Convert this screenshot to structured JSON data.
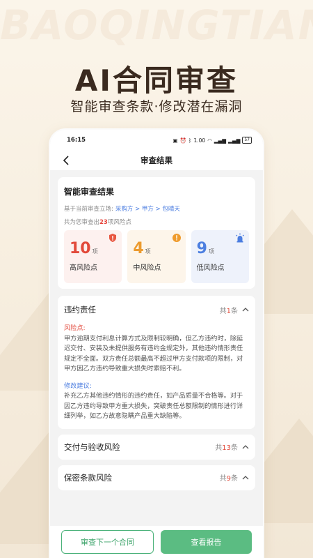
{
  "watermark": "BAOQINGTIAN",
  "hero": {
    "title": "AI合同审查",
    "subtitle": "智能审查条款·修改潜在漏洞"
  },
  "statusbar": {
    "time": "16:15",
    "icons": [
      "nfc-icon",
      "alarm-icon",
      "bluetooth-icon",
      "speed-readout",
      "wifi-icon",
      "signal-icon",
      "signal-icon",
      "battery-icon"
    ],
    "speed": "1.00",
    "battery": "57"
  },
  "nav": {
    "title": "审查结果"
  },
  "summary": {
    "title": "智能审查结果",
    "stance_label": "基于当前审查立场:",
    "stance_path": "采购方 > 甲方 > 包晴天",
    "count_prefix": "共为您审查出",
    "count_num": "23",
    "count_suffix": "项风险点",
    "boxes": [
      {
        "num": "10",
        "unit": "项",
        "label": "高风险点",
        "color": "#e24a3b"
      },
      {
        "num": "4",
        "unit": "项",
        "label": "中风险点",
        "color": "#ec9b2f"
      },
      {
        "num": "9",
        "unit": "项",
        "label": "低风险点",
        "color": "#4d7fe0"
      }
    ]
  },
  "sections": [
    {
      "title": "违约责任",
      "count_prefix": "共",
      "count_num": "1",
      "count_suffix": "条",
      "expanded": true,
      "risk_label": "风险点:",
      "risk_text": "甲方逾期支付利息计算方式及限制较明确，但乙方违约时，除延迟交付、安装及未提供服务有违约金规定外，其他违约情形责任规定不全面。双方责任总额最高不超过甲方支付款项的限制，对甲方因乙方违约导致重大损失时索赔不利。",
      "fix_label": "修改建议:",
      "fix_text": "补充乙方其他违约情形的违约责任，如产品质量不合格等。对于因乙方违约导致甲方重大损失，突破责任总额限制的情形进行详细列举，如乙方故意隐瞒产品重大缺陷等。"
    },
    {
      "title": "交付与验收风险",
      "count_prefix": "共",
      "count_num": "13",
      "count_suffix": "条",
      "expanded": false
    },
    {
      "title": "保密条款风险",
      "count_prefix": "共",
      "count_num": "9",
      "count_suffix": "条",
      "expanded": false
    }
  ],
  "actions": {
    "next_contract": "审查下一个合同",
    "view_report": "查看报告"
  },
  "colors": {
    "accent_green": "#5bbc82",
    "high": "#e24a3b",
    "mid": "#ec9b2f",
    "low": "#4d7fe0"
  }
}
